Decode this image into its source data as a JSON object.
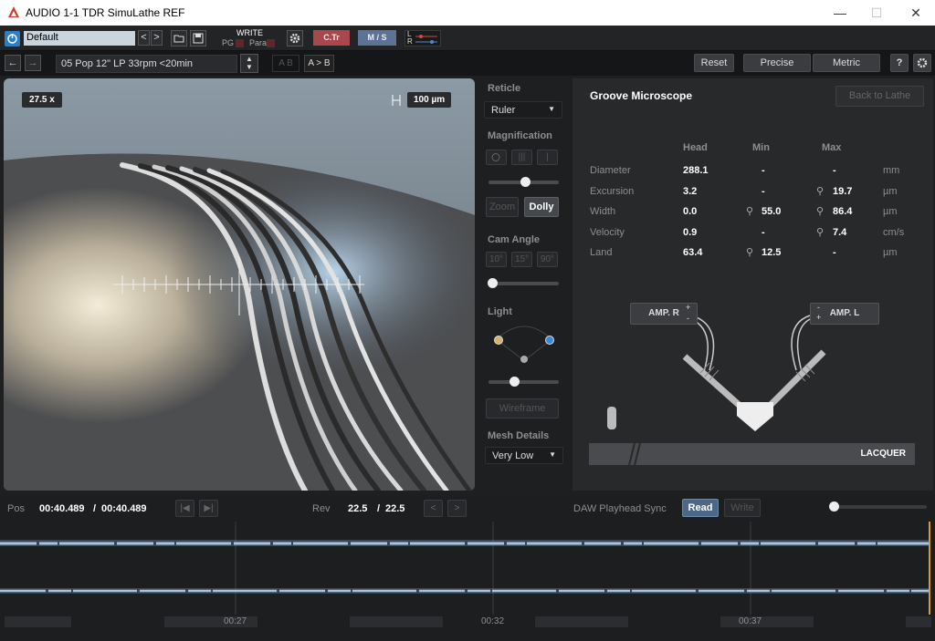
{
  "window": {
    "title": "AUDIO 1-1 TDR SimuLathe REF",
    "minimize": "—",
    "maximize": "☐",
    "close": "✕"
  },
  "toolbar": {
    "preset": "Default",
    "pg": "PG",
    "write": "WRITE",
    "para": "Para",
    "ctr": "C.Tr",
    "ms": "M / S",
    "l": "L",
    "r": "R"
  },
  "toolbar2": {
    "track": "05 Pop 12\" LP 33rpm <20min",
    "ab": "A B",
    "a_to_b": "A > B",
    "reset": "Reset",
    "precise": "Precise",
    "metric": "Metric",
    "help": "?"
  },
  "viewer": {
    "zoom": "27.5 x",
    "scale": "100 µm"
  },
  "controls": {
    "reticle": "Reticle",
    "reticle_value": "Ruler",
    "magnification": "Magnification",
    "zoom": "Zoom",
    "dolly": "Dolly",
    "cam_angle": "Cam Angle",
    "a10": "10°",
    "a15": "15°",
    "a90": "90°",
    "light": "Light",
    "wireframe": "Wireframe",
    "mesh_details": "Mesh Details",
    "mesh_value": "Very Low"
  },
  "microscope": {
    "title": "Groove Microscope",
    "back": "Back to Lathe",
    "headers": [
      "Head",
      "Min",
      "Max"
    ],
    "rows": [
      {
        "name": "Diameter",
        "head": "288.1",
        "min": "-",
        "max": "-",
        "unit": "mm"
      },
      {
        "name": "Excursion",
        "head": "3.2",
        "min": "-",
        "max": "19.7",
        "unit": "µm"
      },
      {
        "name": "Width",
        "head": "0.0",
        "min": "55.0",
        "max": "86.4",
        "unit": "µm"
      },
      {
        "name": "Velocity",
        "head": "0.9",
        "min": "-",
        "max": "7.4",
        "unit": "cm/s"
      },
      {
        "name": "Land",
        "head": "63.4",
        "min": "12.5",
        "max": "-",
        "unit": "µm"
      }
    ],
    "amp_r": "AMP. R",
    "amp_l": "AMP. L",
    "plus": "+",
    "minus": "-",
    "lacquer": "LACQUER"
  },
  "transport": {
    "pos": "Pos",
    "pos_value": "00:40.489",
    "pos_sep": "/",
    "pos_total": "00:40.489",
    "rev": "Rev",
    "rev_value": "22.5",
    "rev_sep": "/",
    "rev_total": "22.5",
    "sync": "DAW Playhead Sync",
    "read": "Read",
    "write": "Write"
  },
  "timeline": {
    "ticks": [
      "00:27",
      "00:32",
      "00:37"
    ]
  }
}
